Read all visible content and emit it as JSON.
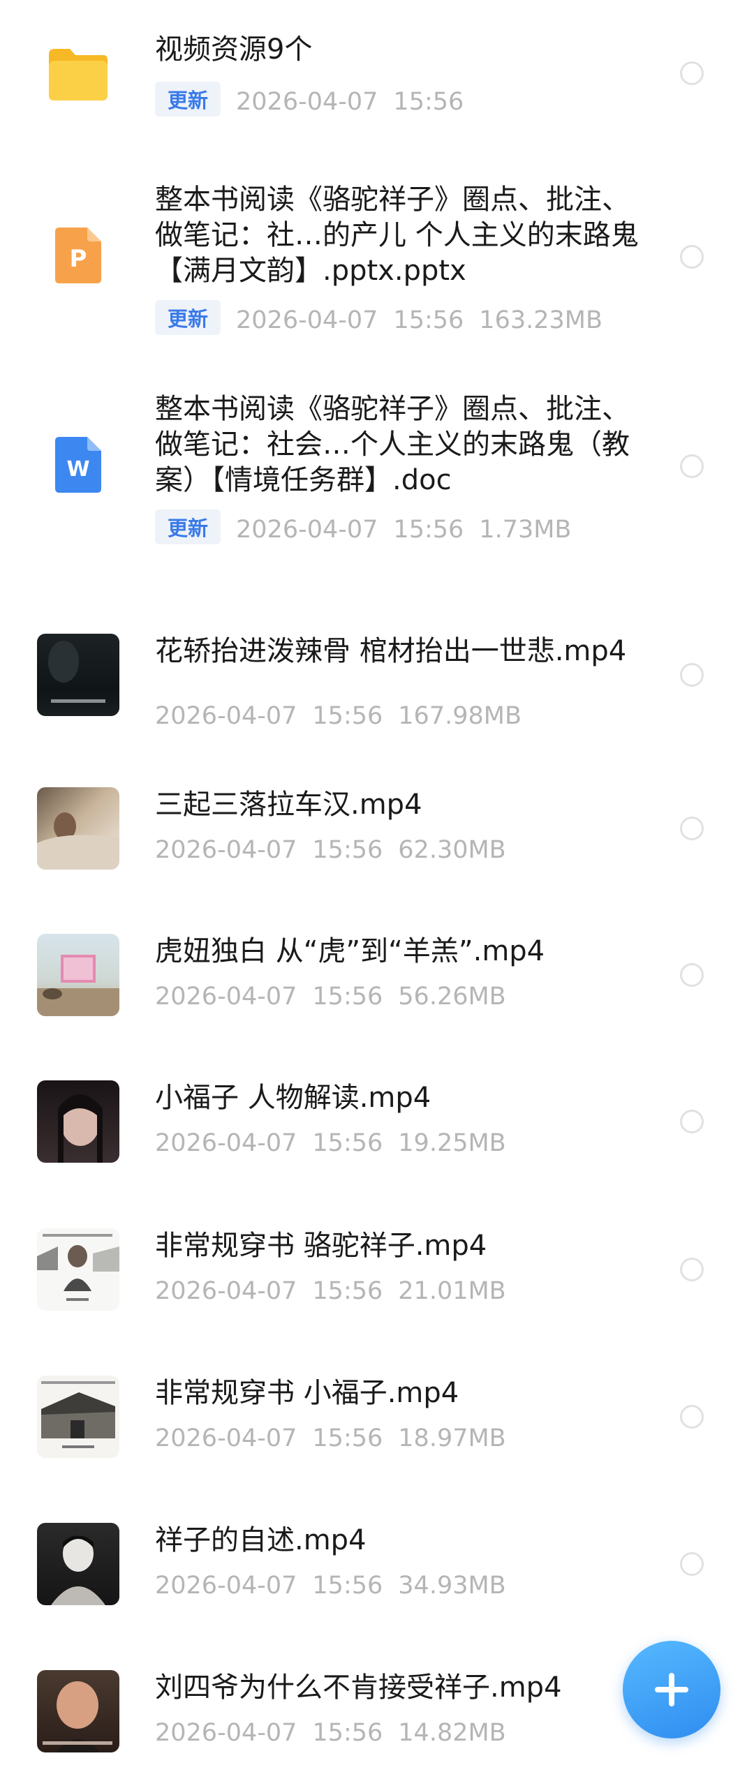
{
  "files": [
    {
      "name": "视频资源9个",
      "badge": "更新",
      "date": "2026-04-07",
      "time": "15:56",
      "size": "",
      "icon": "folder-icon"
    },
    {
      "name": "整本书阅读《骆驼祥子》圈点、批注、做笔记：社…的产儿 个人主义的末路鬼【满月文韵】.pptx.pptx",
      "badge": "更新",
      "date": "2026-04-07",
      "time": "15:56",
      "size": "163.23MB",
      "icon": "pptx-icon"
    },
    {
      "name": "整本书阅读《骆驼祥子》圈点、批注、做笔记：社会…个人主义的末路鬼（教案）【情境任务群】.doc",
      "badge": "更新",
      "date": "2026-04-07",
      "time": "15:56",
      "size": "1.73MB",
      "icon": "word-doc-icon"
    },
    {
      "name": "花轿抬进泼辣骨 棺材抬出一世悲.mp4",
      "date": "2026-04-07",
      "time": "15:56",
      "size": "167.98MB",
      "icon": "video-thumbnail"
    },
    {
      "name": "三起三落拉车汉.mp4",
      "date": "2026-04-07",
      "time": "15:56",
      "size": "62.30MB",
      "icon": "video-thumbnail"
    },
    {
      "name": "虎妞独白 从“虎”到“羊羔”.mp4",
      "date": "2026-04-07",
      "time": "15:56",
      "size": "56.26MB",
      "icon": "video-thumbnail"
    },
    {
      "name": "小福子 人物解读.mp4",
      "date": "2026-04-07",
      "time": "15:56",
      "size": "19.25MB",
      "icon": "video-thumbnail"
    },
    {
      "name": "非常规穿书 骆驼祥子.mp4",
      "date": "2026-04-07",
      "time": "15:56",
      "size": "21.01MB",
      "icon": "video-thumbnail"
    },
    {
      "name": "非常规穿书 小福子.mp4",
      "date": "2026-04-07",
      "time": "15:56",
      "size": "18.97MB",
      "icon": "video-thumbnail"
    },
    {
      "name": "祥子的自述.mp4",
      "date": "2026-04-07",
      "time": "15:56",
      "size": "34.93MB",
      "icon": "video-thumbnail"
    },
    {
      "name": "刘四爷为什么不肯接受祥子.mp4",
      "date": "2026-04-07",
      "time": "15:56",
      "size": "14.82MB",
      "icon": "video-thumbnail"
    }
  ],
  "fab": {
    "icon": "plus-icon"
  },
  "colors": {
    "accent": "#3a8ff0",
    "meta_text": "#b5b5b5",
    "badge_text": "#3a7ae8",
    "folder": "#fcc93a",
    "pptx": "#f59a45",
    "doc": "#3d87f0"
  }
}
